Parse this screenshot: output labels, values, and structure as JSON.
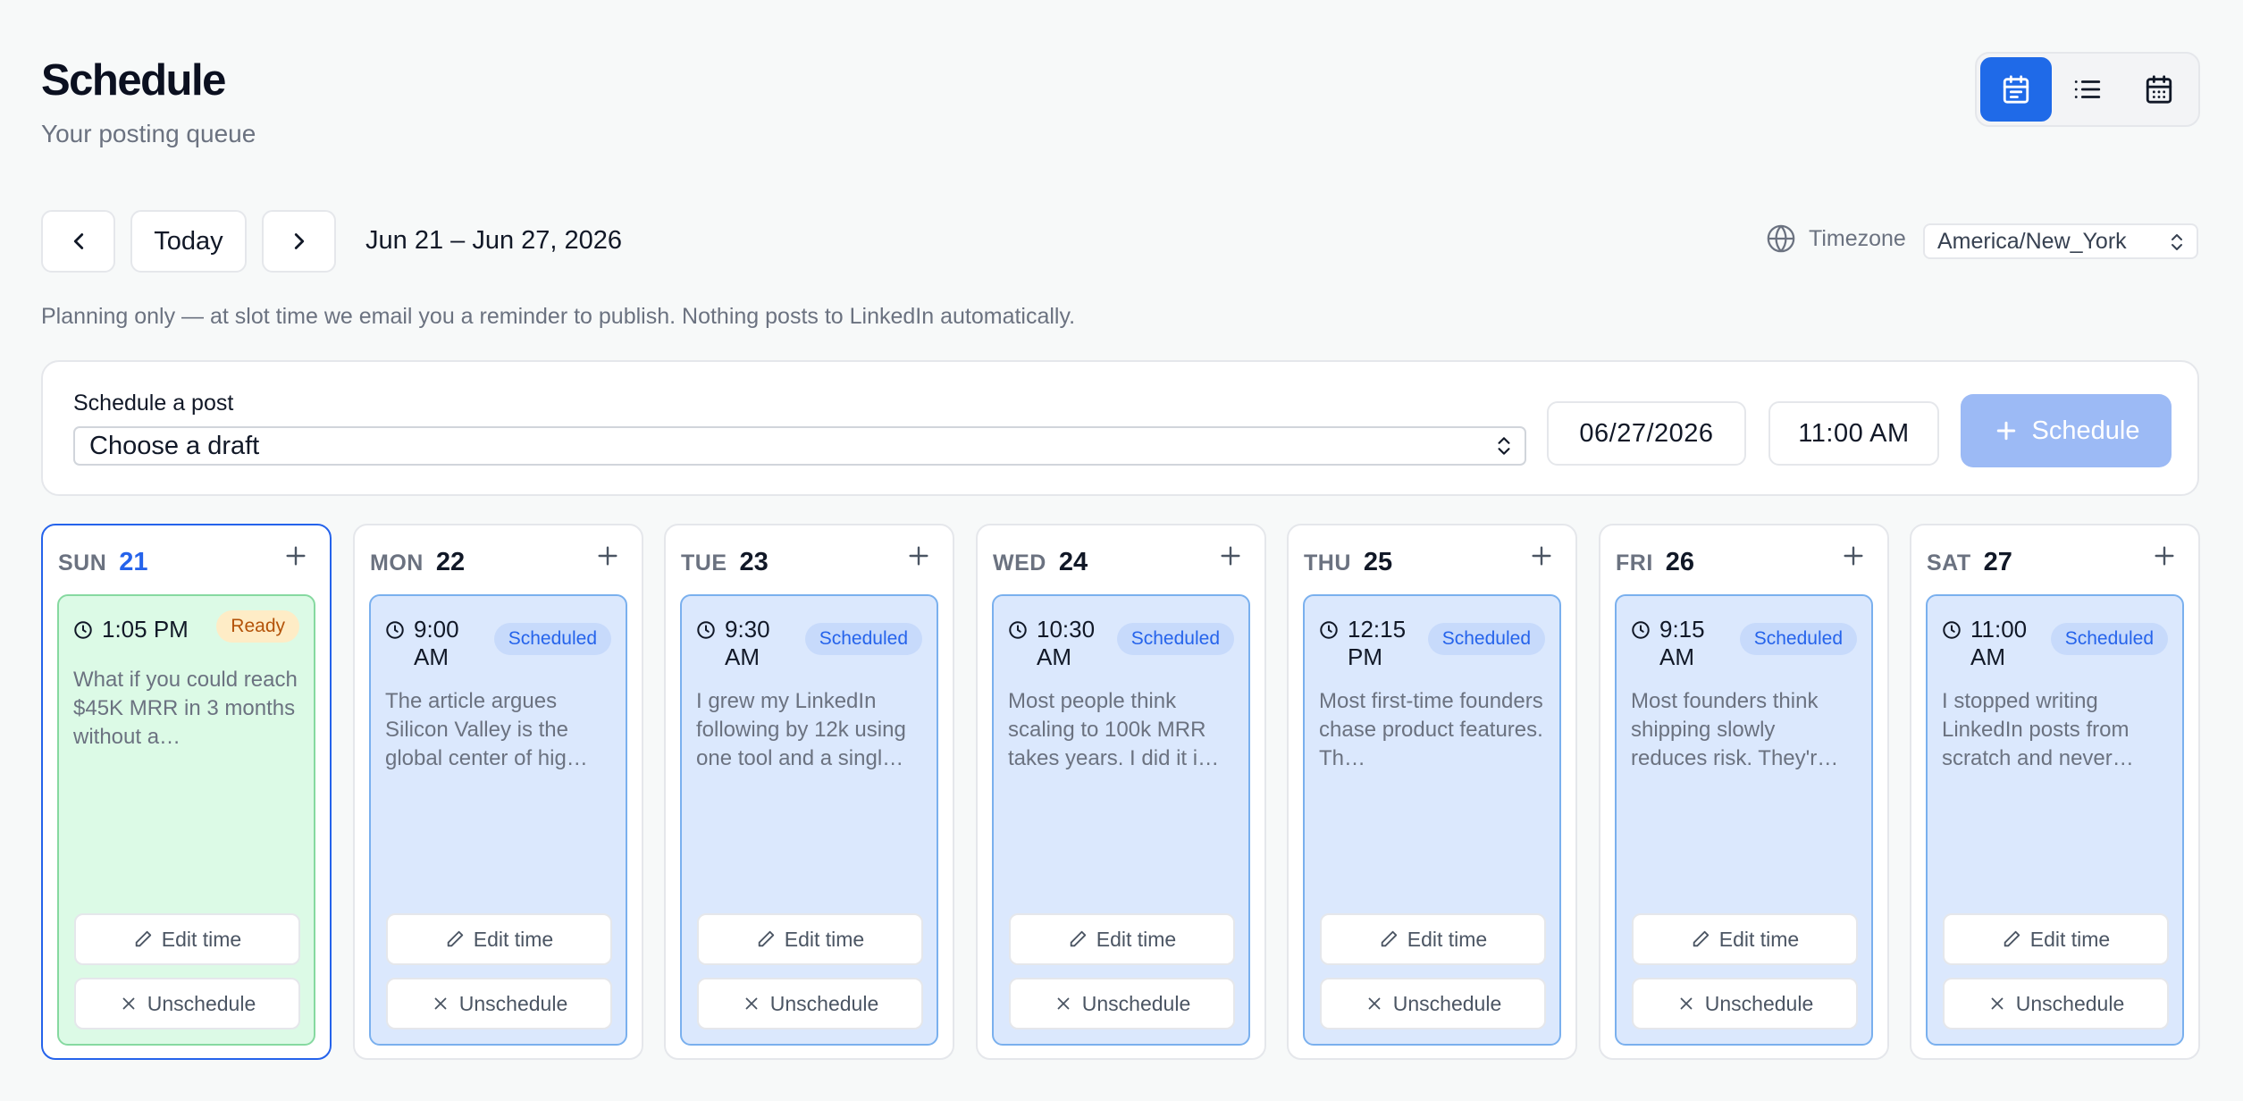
{
  "header": {
    "title": "Schedule",
    "subtitle": "Your posting queue"
  },
  "view_toggle": [
    {
      "name": "week-view",
      "icon": "calendar-week-icon",
      "active": true
    },
    {
      "name": "list-view",
      "icon": "list-icon",
      "active": false
    },
    {
      "name": "month-view",
      "icon": "calendar-month-icon",
      "active": false
    }
  ],
  "nav": {
    "prev_icon": "chevron-left-icon",
    "today_label": "Today",
    "next_icon": "chevron-right-icon",
    "range": "Jun 21 – Jun 27, 2026"
  },
  "timezone": {
    "icon": "globe-icon",
    "label": "Timezone",
    "value": "America/New_York"
  },
  "note": "Planning only — at slot time we email you a reminder to publish. Nothing posts to LinkedIn automatically.",
  "composer": {
    "label": "Schedule a post",
    "draft_placeholder": "Choose a draft",
    "date": "06/27/2026",
    "time": "11:00 AM",
    "schedule_label": "Schedule"
  },
  "colors": {
    "accent": "#1f6ae8",
    "scheduled_bg": "#dbe8fd",
    "ready_bg": "#dcfae6",
    "ready_badge": "#feecc6"
  },
  "card_actions": {
    "edit": "Edit time",
    "unschedule": "Unschedule"
  },
  "days": [
    {
      "name": "SUN",
      "num": "21",
      "today": true,
      "post": {
        "time": "1:05 PM",
        "status": "Ready",
        "text": "What if you could reach $45K MRR in 3 months without a…"
      }
    },
    {
      "name": "MON",
      "num": "22",
      "today": false,
      "post": {
        "time": "9:00 AM",
        "status": "Scheduled",
        "text": "The article argues Silicon Valley is the global center of hig…"
      }
    },
    {
      "name": "TUE",
      "num": "23",
      "today": false,
      "post": {
        "time": "9:30 AM",
        "status": "Scheduled",
        "text": "I grew my LinkedIn following by 12k using one tool and a singl…"
      }
    },
    {
      "name": "WED",
      "num": "24",
      "today": false,
      "post": {
        "time": "10:30 AM",
        "status": "Scheduled",
        "text": "Most people think scaling to 100k MRR takes years. I did it i…"
      }
    },
    {
      "name": "THU",
      "num": "25",
      "today": false,
      "post": {
        "time": "12:15 PM",
        "status": "Scheduled",
        "text": "Most first-time founders chase product features. Th…"
      }
    },
    {
      "name": "FRI",
      "num": "26",
      "today": false,
      "post": {
        "time": "9:15 AM",
        "status": "Scheduled",
        "text": "Most founders think shipping slowly reduces risk. They'r…"
      }
    },
    {
      "name": "SAT",
      "num": "27",
      "today": false,
      "post": {
        "time": "11:00 AM",
        "status": "Scheduled",
        "text": "I stopped writing LinkedIn posts from scratch and never…"
      }
    }
  ]
}
